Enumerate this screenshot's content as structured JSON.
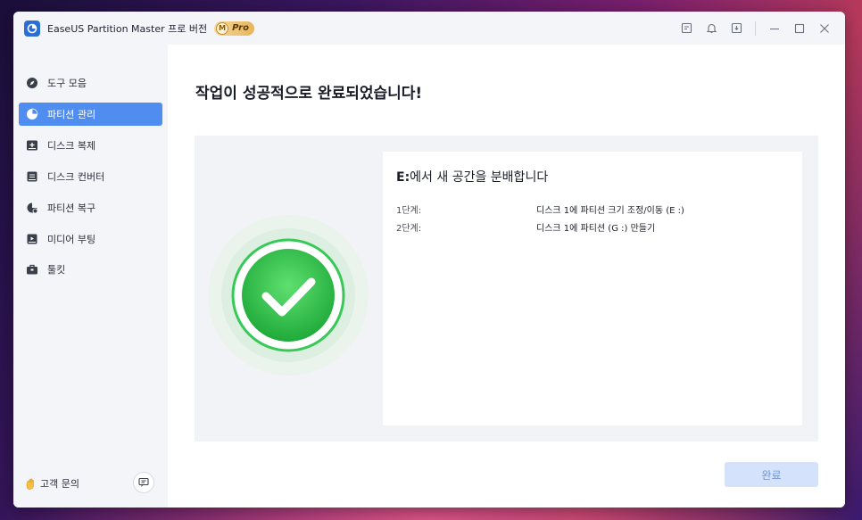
{
  "window": {
    "title": "EaseUS Partition Master 프로 버전",
    "badge_letter": "M",
    "badge_label": "Pro"
  },
  "sidebar": {
    "items": [
      {
        "label": "도구 모음",
        "icon": "compass-icon"
      },
      {
        "label": "파티션 관리",
        "icon": "pie-chart-icon",
        "active": true
      },
      {
        "label": "디스크 복제",
        "icon": "disk-clone-icon"
      },
      {
        "label": "디스크 컨버터",
        "icon": "disk-convert-icon"
      },
      {
        "label": "파티션 복구",
        "icon": "partition-recovery-icon"
      },
      {
        "label": "미디어 부팅",
        "icon": "media-boot-icon"
      },
      {
        "label": "툴킷",
        "icon": "toolkit-icon"
      }
    ],
    "support_label": "고객 문의"
  },
  "main": {
    "title": "작업이 성공적으로 완료되었습니다!",
    "card": {
      "title_drive": "E:",
      "title_rest": "에서 새 공간을 분배합니다",
      "steps": [
        {
          "label": "1단계:",
          "value": "디스크 1에 파티션 크기 조정/이동 (E :)"
        },
        {
          "label": "2단계:",
          "value": "디스크 1에 파티션 (G :) 만들기"
        }
      ]
    },
    "done_button": "완료"
  },
  "colors": {
    "accent": "#4f8ef0",
    "success": "#2ec84a",
    "done_button_bg": "#d4e3fb"
  }
}
